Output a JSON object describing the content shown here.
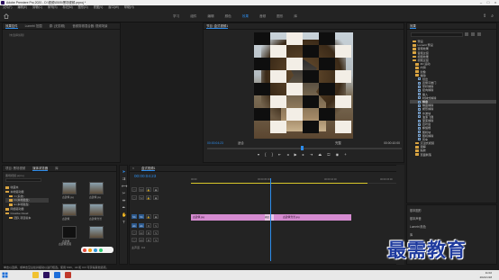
{
  "app": {
    "title": "Adobe Premiere Pro 2020 - D:\\视频\\0505\\黑场视频.prproj *"
  },
  "menu": [
    "文件(F)",
    "编辑(E)",
    "剪辑(C)",
    "序列(S)",
    "标记(M)",
    "图形(G)",
    "视图(V)",
    "窗口(W)",
    "帮助(H)"
  ],
  "workspaces": {
    "items": [
      "学习",
      "组件",
      "编辑",
      "颜色",
      "效果",
      "音频",
      "图形",
      "库"
    ],
    "active": "效果"
  },
  "effect_controls": {
    "tabs": [
      "效果控件",
      "Lumetri 范围",
      "源: (无剪辑)",
      "音频剪辑混合器: 视频场景"
    ],
    "hint": "（未选择剪辑）"
  },
  "program_monitor": {
    "title": "节目: 盒式视频1",
    "timecode_left": "00:00:04:23",
    "fit": "适合",
    "quality": "完整",
    "timecode_right": "00:00:10:00"
  },
  "effects_panel": {
    "tabs": [
      "效果"
    ],
    "tree": [
      {
        "label": "预设",
        "type": "folder",
        "indent": 1
      },
      {
        "label": "Lumetri 预设",
        "type": "folder",
        "indent": 1
      },
      {
        "label": "音频效果",
        "type": "folder",
        "indent": 1
      },
      {
        "label": "音频过渡",
        "type": "folder",
        "indent": 1
      },
      {
        "label": "视频效果",
        "type": "folder",
        "indent": 1
      },
      {
        "label": "视频过渡",
        "type": "folder",
        "indent": 1
      },
      {
        "label": "3D 运动",
        "type": "folder",
        "indent": 2
      },
      {
        "label": "内滑",
        "type": "folder",
        "indent": 2
      },
      {
        "label": "划像",
        "type": "folder",
        "indent": 2
      },
      {
        "label": "擦除",
        "type": "folder",
        "indent": 2
      },
      {
        "label": "划出",
        "type": "fx",
        "indent": 3
      },
      {
        "label": "双侧平推门",
        "type": "fx",
        "indent": 3
      },
      {
        "label": "带状擦除",
        "type": "fx",
        "indent": 3
      },
      {
        "label": "径向擦除",
        "type": "fx",
        "indent": 3
      },
      {
        "label": "插入",
        "type": "fx",
        "indent": 3
      },
      {
        "label": "时钟式擦除",
        "type": "fx",
        "indent": 3
      },
      {
        "label": "棋盘",
        "type": "fx",
        "indent": 3,
        "selected": true
      },
      {
        "label": "棋盘擦除",
        "type": "fx",
        "indent": 3
      },
      {
        "label": "楔形擦除",
        "type": "fx",
        "indent": 3
      },
      {
        "label": "水波块",
        "type": "fx",
        "indent": 3
      },
      {
        "label": "油漆飞溅",
        "type": "fx",
        "indent": 3
      },
      {
        "label": "渐变擦除",
        "type": "fx",
        "indent": 3
      },
      {
        "label": "百叶窗",
        "type": "fx",
        "indent": 3
      },
      {
        "label": "螺旋框",
        "type": "fx",
        "indent": 3
      },
      {
        "label": "随机块",
        "type": "fx",
        "indent": 3
      },
      {
        "label": "随机擦除",
        "type": "fx",
        "indent": 3
      },
      {
        "label": "风车",
        "type": "fx",
        "indent": 3
      },
      {
        "label": "沉浸式视频",
        "type": "folder",
        "indent": 2
      },
      {
        "label": "溶解",
        "type": "folder",
        "indent": 2
      },
      {
        "label": "缩放",
        "type": "folder",
        "indent": 2
      },
      {
        "label": "页面剥落",
        "type": "folder",
        "indent": 2
      }
    ],
    "bottom": [
      "基本图形",
      "基本声音",
      "Lumetri 颜色",
      "库",
      "标记"
    ]
  },
  "project": {
    "tabs": [
      "项目: 黑场视频",
      "媒体浏览器",
      "库"
    ],
    "info": "黑场视频.prproj",
    "bins": [
      {
        "label": "收藏夹"
      },
      {
        "label": "本地驱动器"
      },
      {
        "label": "C:(系统)"
      },
      {
        "label": "D:(本地磁盘)"
      },
      {
        "label": "E:(本地磁盘)"
      },
      {
        "label": "网络驱动器"
      },
      {
        "label": "Creative Cloud"
      },
      {
        "label": "团队 项目版本"
      }
    ],
    "thumbs": [
      "古建筑.jpg",
      "古建筑.jpg",
      "古建筑",
      "古建筑雪景",
      "古建筑",
      "古建筑视频"
    ]
  },
  "timeline": {
    "title": "盒式视频1",
    "timecode": "00:00:04:23",
    "ruler": [
      "00:00",
      "00:00:05:00",
      "00:00:10:00",
      "00:00:15:00"
    ],
    "tracks": [
      "V3",
      "V2",
      "V1",
      "A1",
      "A2",
      "A3",
      "主声道"
    ],
    "master_value": "0.0",
    "clips": [
      {
        "label": "古建筑.jpg",
        "track": "V1"
      },
      {
        "label": "古建筑雪景.jpg",
        "track": "V1"
      }
    ],
    "transition": "棋盘"
  },
  "status": "单击以选择，或单击空白处并拖动以进行框选。使用 Shift、Alt 和 Ctrl 可获得其他选项。",
  "watermark": "最需教育",
  "clock": {
    "time": "11:02",
    "date": "2021/1/18"
  }
}
